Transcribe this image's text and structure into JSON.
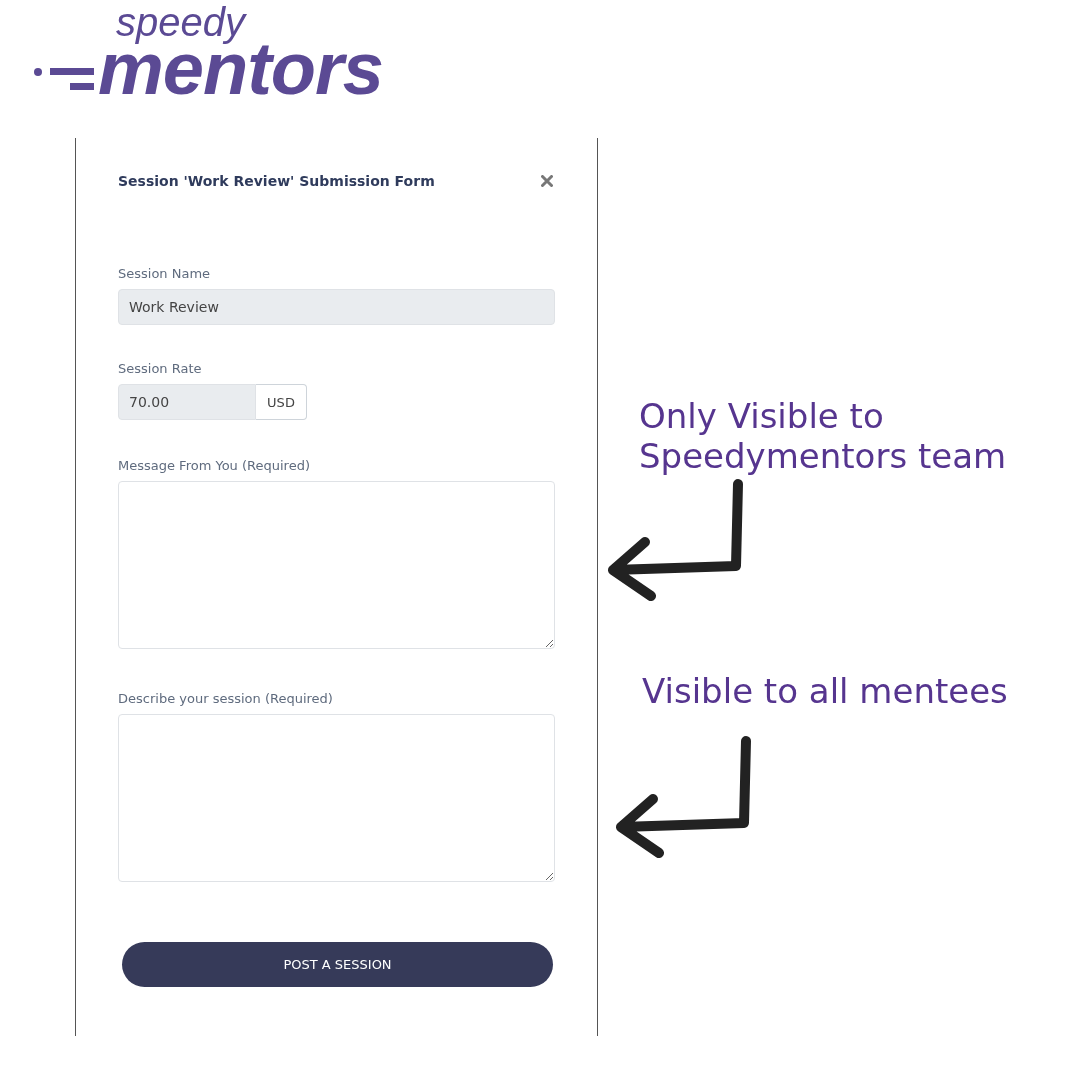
{
  "logo": {
    "top": "speedy",
    "bottom": "mentors"
  },
  "form": {
    "title": "Session 'Work Review' Submission Form",
    "fields": [
      {
        "kind": "text",
        "label": "Session Name",
        "value": "Work Review",
        "disabled": true
      },
      {
        "kind": "currency",
        "label": "Session Rate",
        "value": "70.00",
        "addon": "USD",
        "disabled": true
      },
      {
        "kind": "textarea",
        "label": "Message From You (Required)",
        "disabled": false
      },
      {
        "kind": "textarea",
        "label": "Describe your session (Required)",
        "disabled": false
      }
    ],
    "submit": "POST A SESSION"
  },
  "notes": [
    {
      "text": "Only Visible to Speedymentors team"
    },
    {
      "text": "Visible to all mentees"
    }
  ]
}
